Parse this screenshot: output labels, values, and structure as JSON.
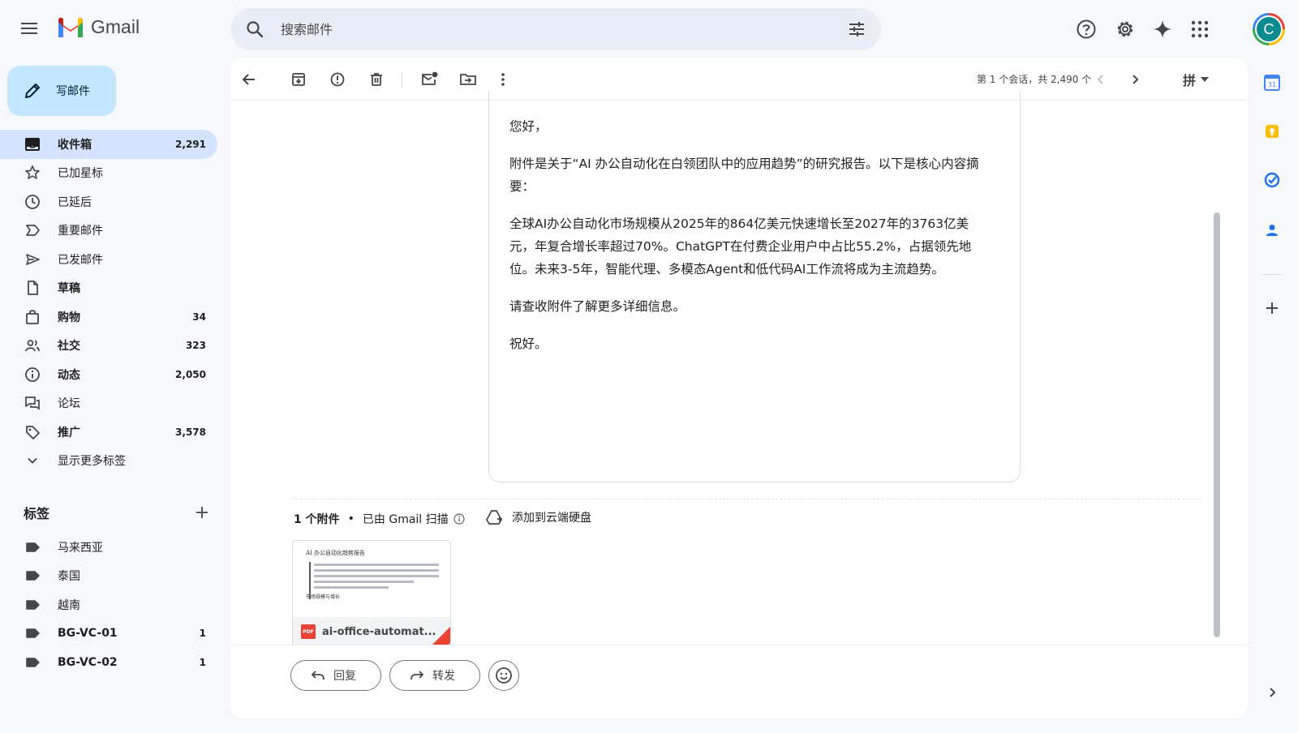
{
  "app": {
    "name": "Gmail"
  },
  "search": {
    "placeholder": "搜索邮件"
  },
  "compose": {
    "label": "写邮件"
  },
  "nav": [
    {
      "label": "收件箱",
      "count": "2,291",
      "bold": true,
      "active": true,
      "icon": "inbox-icon"
    },
    {
      "label": "已加星标",
      "count": "",
      "bold": false,
      "icon": "star-icon"
    },
    {
      "label": "已延后",
      "count": "",
      "bold": false,
      "icon": "clock-icon"
    },
    {
      "label": "重要邮件",
      "count": "",
      "bold": false,
      "icon": "important-icon"
    },
    {
      "label": "已发邮件",
      "count": "",
      "bold": false,
      "icon": "send-icon"
    },
    {
      "label": "草稿",
      "count": "",
      "bold": true,
      "icon": "draft-icon"
    },
    {
      "label": "购物",
      "count": "34",
      "bold": true,
      "icon": "shopping-icon"
    },
    {
      "label": "社交",
      "count": "323",
      "bold": true,
      "icon": "social-icon"
    },
    {
      "label": "动态",
      "count": "2,050",
      "bold": true,
      "icon": "updates-icon"
    },
    {
      "label": "论坛",
      "count": "",
      "bold": false,
      "icon": "forums-icon"
    },
    {
      "label": "推广",
      "count": "3,578",
      "bold": true,
      "icon": "tag-icon"
    },
    {
      "label": "显示更多标签",
      "count": "",
      "bold": false,
      "icon": "chevron-down-icon"
    }
  ],
  "labels": {
    "title": "标签",
    "items": [
      {
        "label": "马来西亚",
        "count": "",
        "bold": false
      },
      {
        "label": "泰国",
        "count": "",
        "bold": false
      },
      {
        "label": "越南",
        "count": "",
        "bold": false
      },
      {
        "label": "BG-VC-01",
        "count": "1",
        "bold": true
      },
      {
        "label": "BG-VC-02",
        "count": "1",
        "bold": true
      }
    ]
  },
  "toolbar": {
    "pager": "第 1 个会话，共 2,490 个",
    "lang": "拼"
  },
  "message": {
    "paragraphs": [
      "您好，",
      "附件是关于“AI 办公自动化在白领团队中的应用趋势”的研究报告。以下是核心内容摘要：",
      "全球AI办公自动化市场规模从2025年的864亿美元快速增长至2027年的3763亿美元，年复合增长率超过70%。ChatGPT在付费企业用户中占比55.2%，占据领先地位。未来3-5年，智能代理、多模态Agent和低代码AI工作流将成为主流趋势。",
      "请查收附件了解更多详细信息。",
      "祝好。"
    ]
  },
  "attachments": {
    "count_label": "1 个附件",
    "scan_label": "已由 Gmail 扫描",
    "drive_label": "添加到云端硬盘",
    "file": {
      "name": "ai-office-automat...",
      "type_badge": "PDF",
      "thumb_title": "AI 办公自动化趋势报告",
      "thumb_section": "市场规模与增长"
    }
  },
  "actions": {
    "reply": "回复",
    "forward": "转发"
  },
  "avatar": {
    "letter": "C"
  },
  "colors": {
    "compose": "#c2e7ff",
    "active_nav": "#d3e3fd",
    "background": "#f6f8fc",
    "avatar": "#0b8a8f"
  }
}
